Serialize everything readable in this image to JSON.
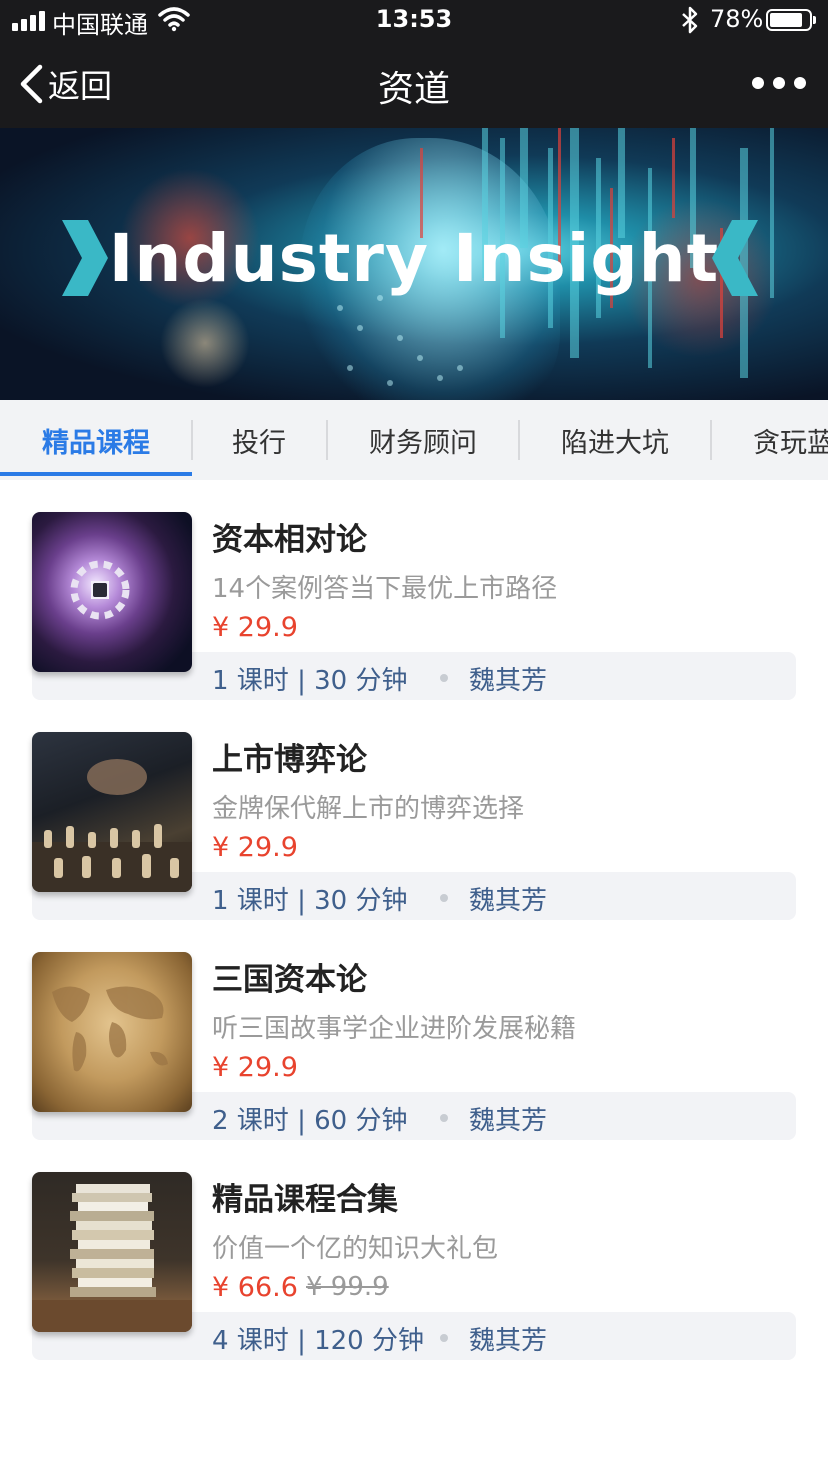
{
  "status_bar": {
    "carrier": "中国联通",
    "time": "13:53",
    "battery": "78%",
    "battery_level": 0.78
  },
  "nav": {
    "back_label": "返回",
    "title": "资道"
  },
  "banner": {
    "title": "Industry Insight"
  },
  "tabs": [
    {
      "label": "精品课程",
      "active": true
    },
    {
      "label": "投行",
      "active": false
    },
    {
      "label": "财务顾问",
      "active": false
    },
    {
      "label": "陷进大坑",
      "active": false
    },
    {
      "label": "贪玩蓝",
      "active": false
    }
  ],
  "courses": [
    {
      "title": "资本相对论",
      "subtitle": "14个案例答当下最优上市路径",
      "price": "¥ 29.9",
      "original_price": "",
      "meta": "1 课时 | 30 分钟",
      "author": "魏其芳",
      "thumb": "space-station-image"
    },
    {
      "title": "上市博弈论",
      "subtitle": "金牌保代解上市的博弈选择",
      "price": "¥ 29.9",
      "original_price": "",
      "meta": "1 课时 | 30 分钟",
      "author": "魏其芳",
      "thumb": "chess-image"
    },
    {
      "title": "三国资本论",
      "subtitle": "听三国故事学企业进阶发展秘籍",
      "price": "¥ 29.9",
      "original_price": "",
      "meta": "2 课时 | 60 分钟",
      "author": "魏其芳",
      "thumb": "world-map-image"
    },
    {
      "title": "精品课程合集",
      "subtitle": "价值一个亿的知识大礼包",
      "price": "¥ 66.6",
      "original_price": "¥ 99.9",
      "meta": "4 课时 | 120 分钟",
      "author": "魏其芳",
      "thumb": "book-stack-image"
    }
  ],
  "colors": {
    "accent": "#2b7be6",
    "price": "#e8432e",
    "meta": "#3f5f8c",
    "nav_bg": "#1a1a1c"
  }
}
